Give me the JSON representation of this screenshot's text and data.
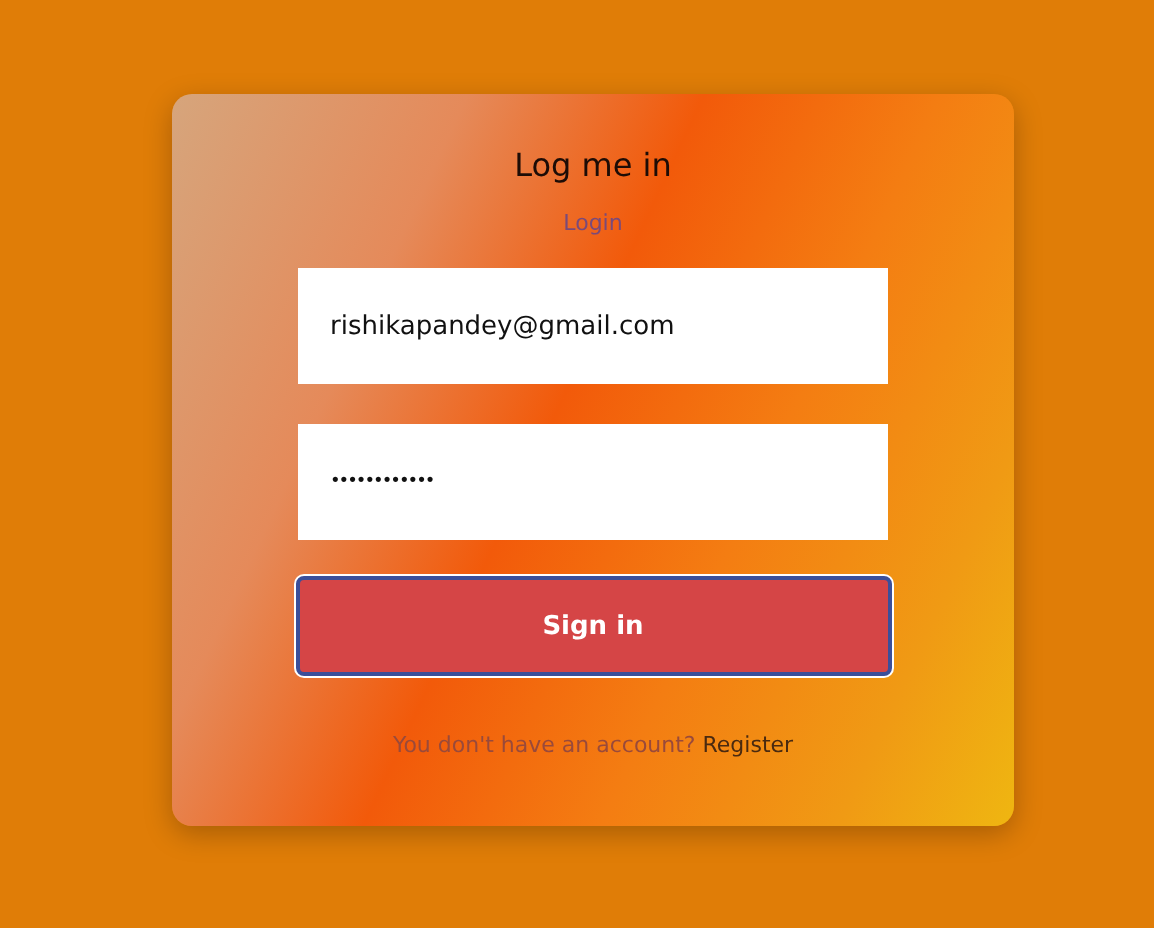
{
  "card": {
    "title": "Log me in",
    "subtitle": "Login"
  },
  "fields": [
    {
      "kind": "email",
      "value": "rishikapandey@gmail.com"
    },
    {
      "kind": "password",
      "value": "••••••••••••"
    }
  ],
  "button": {
    "label": "Sign in",
    "focused": true
  },
  "footer": {
    "text": "You don't have an account?",
    "link": "Register"
  }
}
